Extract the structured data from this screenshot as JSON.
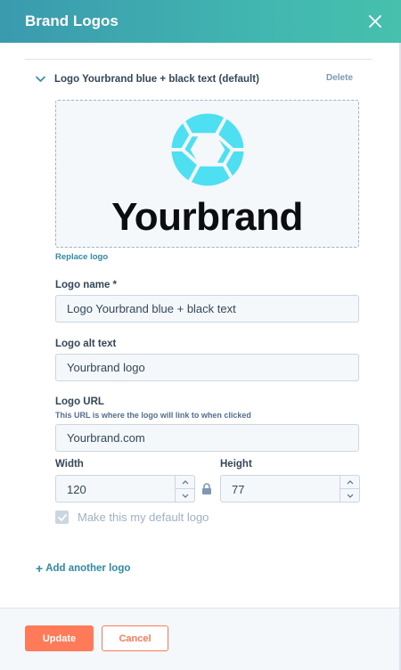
{
  "panel": {
    "title": "Brand Logos"
  },
  "logo": {
    "title": "Logo Yourbrand blue + black text (default)",
    "delete_label": "Delete",
    "preview_wordmark": "Yourbrand",
    "replace_label": "Replace logo",
    "accent_color": "#4ee0f2"
  },
  "fields": {
    "name": {
      "label": "Logo name *",
      "value": "Logo Yourbrand blue + black text"
    },
    "alt": {
      "label": "Logo alt text",
      "value": "Yourbrand logo"
    },
    "url": {
      "label": "Logo URL",
      "help": "This URL is where the logo will link to when clicked",
      "value": "Yourbrand.com"
    },
    "width": {
      "label": "Width",
      "value": "120"
    },
    "height": {
      "label": "Height",
      "value": "77"
    }
  },
  "default_checkbox": {
    "label": "Make this my default logo",
    "checked": true
  },
  "add_logo_label": "Add another logo",
  "footer": {
    "update_label": "Update",
    "cancel_label": "Cancel"
  },
  "colors": {
    "header_gradient_start": "#3a9aae",
    "header_gradient_end": "#47c0ad",
    "primary_button": "#ff7a59",
    "link": "#2e8aa8"
  },
  "icons": [
    "close-icon",
    "chevron-down-icon",
    "aperture-logo-icon",
    "lock-icon",
    "check-icon",
    "caret-up-icon",
    "caret-down-icon",
    "plus-icon"
  ]
}
